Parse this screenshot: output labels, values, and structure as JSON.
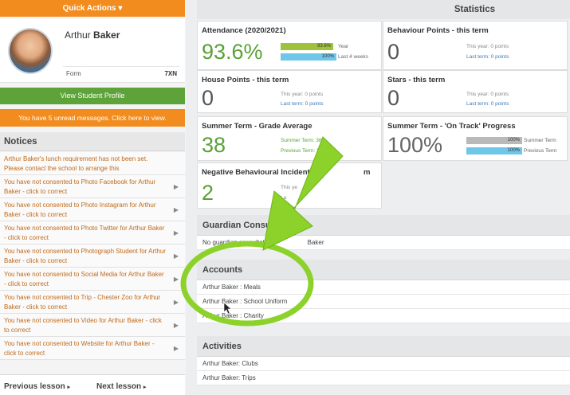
{
  "quick_actions": {
    "label": "Quick Actions"
  },
  "student": {
    "first_name": "Arthur",
    "last_name": "Baker",
    "form_label": "Form",
    "form_value": "7XN",
    "view_profile": "View Student Profile",
    "unread_messages": "You have 5 unread messages. Click here to view."
  },
  "notices": {
    "title": "Notices",
    "items": [
      "Arthur Baker's lunch requirement has not been set. Please contact the school to arrange this",
      "You have not consented to Photo Facebook for Arthur Baker - click to correct",
      "You have not consented to Photo Instagram for Arthur Baker - click to correct",
      "You have not consented to Photo Twitter for Arthur Baker - click to correct",
      "You have not consented to Photograph Student for Arthur Baker - click to correct",
      "You have not consented to Social Media for Arthur Baker - click to correct",
      "You have not consented to Trip - Chester Zoo for Arthur Baker - click to correct",
      "You have not consented to Video for Arthur Baker - click to correct",
      "You have not consented to Website for Arthur Baker - click to correct"
    ]
  },
  "lesson_nav": {
    "prev": "Previous lesson",
    "next": "Next lesson"
  },
  "statistics": {
    "title": "Statistics",
    "attendance": {
      "title": "Attendance (2020/2021)",
      "value": "93.6%",
      "year_pct": "93.6%",
      "year_label": "Year",
      "last4_pct": "100%",
      "last4_label": "Last 4 weeks",
      "year_fill": 0.936,
      "last4_fill": 1.0
    },
    "behaviour": {
      "title": "Behaviour Points - this term",
      "value": "0",
      "this_year": "This year: 0 points",
      "last_term": "Last term: 0 points"
    },
    "house": {
      "title": "House Points - this term",
      "value": "0",
      "this_year": "This year: 0 points",
      "last_term": "Last term: 0 points"
    },
    "stars": {
      "title": "Stars - this term",
      "value": "0",
      "this_year": "This year: 0 points",
      "last_term": "Last term: 0 points"
    },
    "grade": {
      "title": "Summer Term - Grade Average",
      "value": "38",
      "summer": "Summer Term: 38",
      "previous": "Previous Term: 36"
    },
    "on_track": {
      "title": "Summer Term - 'On Track' Progress",
      "value": "100%",
      "summer_pct": "100%",
      "summer_label": "Summer Term",
      "prev_pct": "100%",
      "prev_label": "Previous Term"
    },
    "negative": {
      "title": "Negative Behavioural Incidents",
      "title_end": "m",
      "value": "2",
      "this_year": "This ye",
      "last": "La"
    }
  },
  "guardian": {
    "title": "Guardian Consu",
    "row_start": "No guardian consultati",
    "row_end": "Baker"
  },
  "accounts": {
    "title": "Accounts",
    "items": [
      "Arthur Baker : Meals",
      "Arthur Baker : School Uniform",
      "Arthur Baker : Charity"
    ]
  },
  "activities": {
    "title": "Activities",
    "items": [
      "Arthur Baker: Clubs",
      "Arthur Baker: Trips"
    ]
  },
  "colors": {
    "orange": "#f28c1e",
    "green": "#5ea23a",
    "arrow": "#8cd22a",
    "circle": "#8cd22a"
  }
}
